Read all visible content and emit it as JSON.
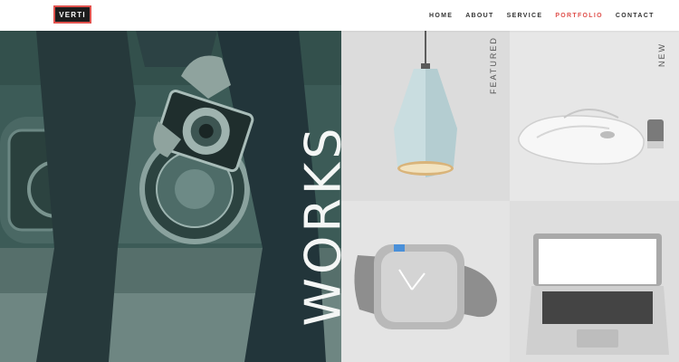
{
  "header": {
    "logo": "VERTI",
    "nav": [
      {
        "label": "HOME",
        "active": false
      },
      {
        "label": "ABOUT",
        "active": false
      },
      {
        "label": "SERVICE",
        "active": false
      },
      {
        "label": "PORTFOLIO",
        "active": true
      },
      {
        "label": "CONTACT",
        "active": false
      }
    ]
  },
  "hero": {
    "title": "WORKS",
    "overlay_color": "#2f4a47"
  },
  "tiles": [
    {
      "name": "pendant-lamp",
      "label": "FEATURED"
    },
    {
      "name": "wireless-mouse",
      "label": "NEW"
    },
    {
      "name": "wrist-watch",
      "label": ""
    },
    {
      "name": "laptop",
      "label": ""
    }
  ],
  "colors": {
    "accent": "#e0524e",
    "logo_bg": "#1c1c1c"
  }
}
